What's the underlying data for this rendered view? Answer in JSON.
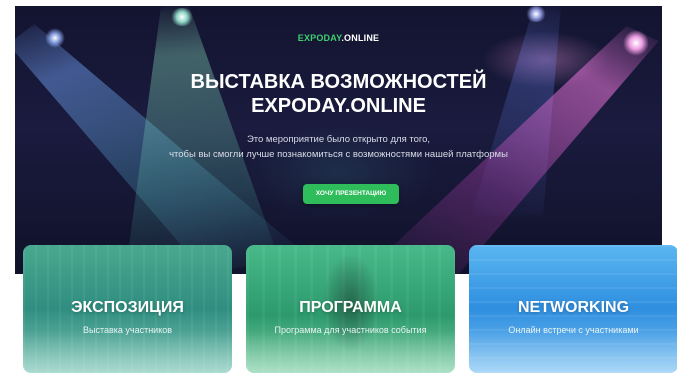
{
  "header": {
    "logo_part1": "EXPODAY",
    "logo_part2": ".ONLINE",
    "title_line1": "ВЫСТАВКА ВОЗМОЖНОСТЕЙ",
    "title_line2": "EXPODAY.ONLINE",
    "desc_line1": "Это мероприятие было открыто для того,",
    "desc_line2": "чтобы вы смогли лучше познакомиться с возможностями нашей платформы",
    "cta_label": "ХОЧУ ПРЕЗЕНТАЦИЮ"
  },
  "cards": [
    {
      "title": "ЭКСПОЗИЦИЯ",
      "subtitle": "Выставка участников"
    },
    {
      "title": "ПРОГРАММА",
      "subtitle": "Программа для участников события"
    },
    {
      "title": "NETWORKING",
      "subtitle": "Онлайн встречи с участниками"
    }
  ],
  "colors": {
    "accent_green": "#2ebd5a",
    "logo_green": "#3dcf6e",
    "hero_bg": "#131430"
  }
}
